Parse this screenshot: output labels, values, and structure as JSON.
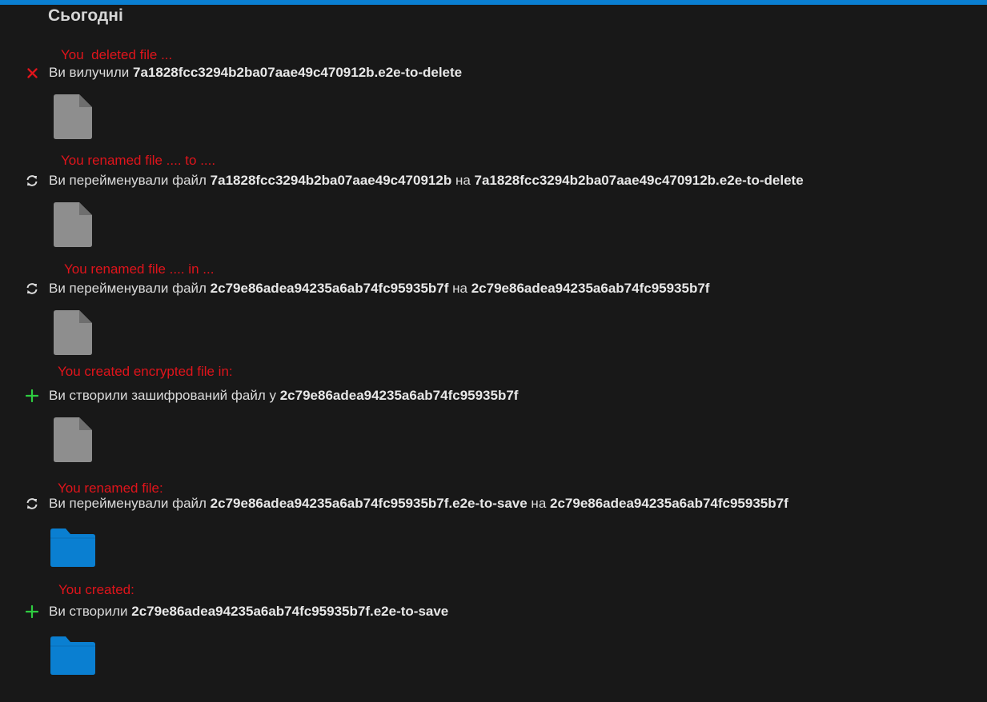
{
  "section": {
    "title": "Сьогодні"
  },
  "colors": {
    "accent": "#0a7fd1",
    "annotation": "#e0141b",
    "delete_icon": "#e0141b",
    "add_icon": "#2ecc40",
    "file_icon": "#8e8e8e",
    "folder_icon": "#0a7fd1"
  },
  "activities": [
    {
      "annotation": "You  deleted file ...",
      "icon": "x-icon",
      "verb": "Ви вилучили ",
      "name1": "7a1828fcc3294b2ba07aae49c470912b.e2e-to-delete",
      "connector": "",
      "name2": "",
      "thumbnail": "file-icon"
    },
    {
      "annotation": "You renamed file .... to ....",
      "icon": "sync-icon",
      "verb": "Ви перейменували файл ",
      "name1": "7a1828fcc3294b2ba07aae49c470912b",
      "connector": " на ",
      "name2": "7a1828fcc3294b2ba07aae49c470912b.e2e-to-delete",
      "thumbnail": "file-icon"
    },
    {
      "annotation": "You renamed file .... in ...",
      "icon": "sync-icon",
      "verb": "Ви перейменували файл ",
      "name1": "2c79e86adea94235a6ab74fc95935b7f",
      "connector": " на ",
      "name2": "2c79e86adea94235a6ab74fc95935b7f",
      "thumbnail": "file-icon"
    },
    {
      "annotation": "You created encrypted file in:",
      "icon": "plus-icon",
      "verb": "Ви створили зашифрований файл у ",
      "name1": "2c79e86adea94235a6ab74fc95935b7f",
      "connector": "",
      "name2": "",
      "thumbnail": "file-icon"
    },
    {
      "annotation": "You renamed file:",
      "icon": "sync-icon",
      "verb": "Ви перейменували файл ",
      "name1": "2c79e86adea94235a6ab74fc95935b7f.e2e-to-save",
      "connector": " на ",
      "name2": "2c79e86adea94235a6ab74fc95935b7f",
      "thumbnail": "folder-icon"
    },
    {
      "annotation": "You created:",
      "icon": "plus-icon",
      "verb": "Ви створили ",
      "name1": "2c79e86adea94235a6ab74fc95935b7f.e2e-to-save",
      "connector": "",
      "name2": "",
      "thumbnail": "folder-icon"
    }
  ]
}
